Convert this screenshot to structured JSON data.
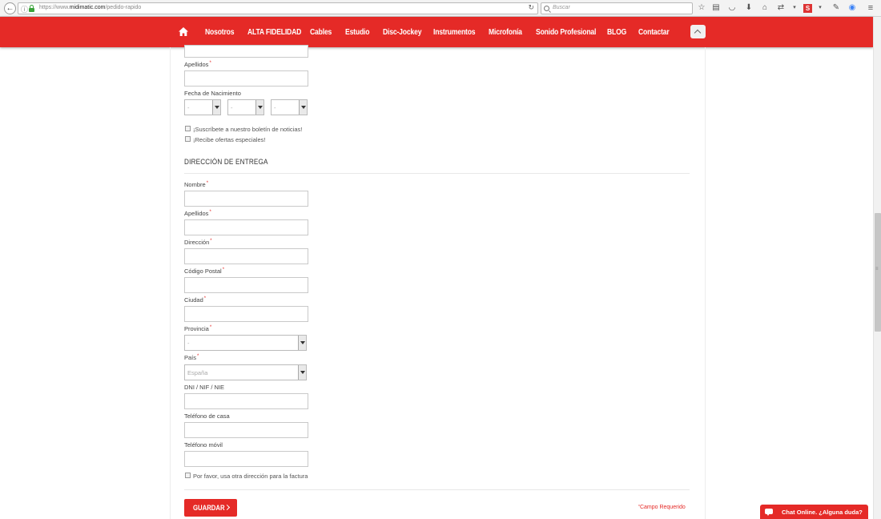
{
  "browser": {
    "url_prefix": "https://www.",
    "url_domain": "midimatic.com",
    "url_path": "/pedido-rapido",
    "search_placeholder": "Buscar"
  },
  "nav": {
    "items": [
      "Nosotros",
      "ALTA FIDELIDAD",
      "Cables",
      "Estudio",
      "Disc-Jockey",
      "Instrumentos",
      "Microfonía",
      "Sonido Profesional",
      "BLOG",
      "Contactar"
    ]
  },
  "personal": {
    "apellidos_label": "Apellidos",
    "birthdate_label": "Fecha de Nacimiento",
    "day_value": "-",
    "month_value": "-",
    "year_value": "-",
    "newsletter_label": "¡Suscríbete a nuestro boletín de noticias!",
    "offers_label": "¡Recibe ofertas especiales!"
  },
  "delivery": {
    "section_title": "DIRECCIÓN DE ENTREGA",
    "nombre_label": "Nombre",
    "apellidos_label": "Apellidos",
    "direccion_label": "Dirección",
    "codigo_postal_label": "Código Postal",
    "ciudad_label": "Ciudad",
    "provincia_label": "Provincia",
    "provincia_value": "-",
    "pais_label": "País",
    "pais_value": "España",
    "dni_label": "DNI / NIF / NIE",
    "telefono_casa_label": "Teléfono de casa",
    "telefono_movil_label": "Teléfono móvil",
    "other_invoice_label": "Por favor, usa otra dirección para la factura"
  },
  "form": {
    "required_marker": "*",
    "save_label": "GUARDAR",
    "required_note": "Campo Requerido"
  },
  "chat": {
    "label": "Chat Online. ¿Alguna duda?"
  },
  "colors": {
    "brand_red": "#e52a27"
  }
}
